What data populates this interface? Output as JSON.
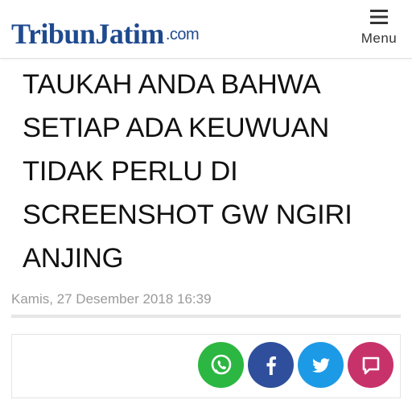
{
  "header": {
    "logo_main": "TribunJatim",
    "logo_suffix": ".com",
    "menu_label": "Menu",
    "menu_icon": "hamburger-icon"
  },
  "article": {
    "headline": "TAUKAH ANDA BAHWA\nSETIAP ADA KEUWUAN\nTIDAK PERLU  DI\nSCREENSHOT GW NGIRI\nANJING",
    "date": "Kamis, 27 Desember 2018 16:39"
  },
  "share": {
    "buttons": [
      {
        "icon": "whatsapp-icon",
        "color": "#2cb742"
      },
      {
        "icon": "facebook-icon",
        "color": "#2f4f9c"
      },
      {
        "icon": "twitter-icon",
        "color": "#1d9ae6"
      },
      {
        "icon": "message-icon",
        "color": "#c8326a"
      }
    ]
  },
  "colors": {
    "brand": "#1f4a8f",
    "headline_text": "#111111",
    "date_text": "#9a9a9a"
  }
}
